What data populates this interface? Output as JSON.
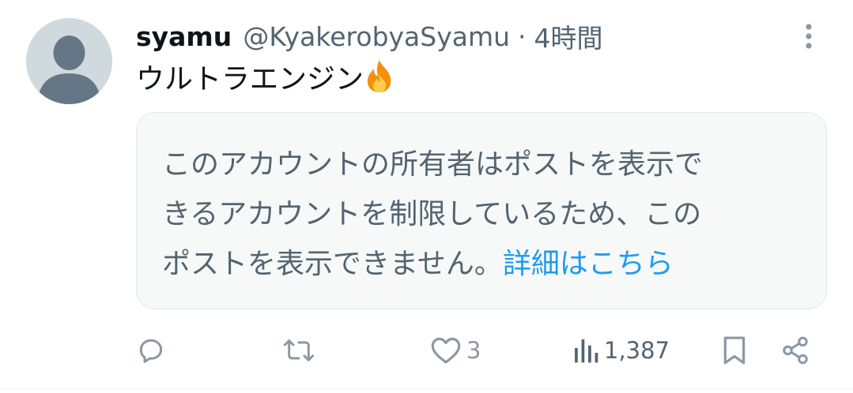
{
  "tweet": {
    "author_name": "syamu",
    "handle": "@KyakerobyaSyamu",
    "separator": "·",
    "time": "4時間",
    "text": "ウルトラエンジン",
    "emoji": "fire-emoji"
  },
  "notice": {
    "line1": "このアカウントの所有者はポストを表示で",
    "line2": "きるアカウントを制限しているため、この",
    "line3": "ポストを表示できません。",
    "link": "詳細はこちら"
  },
  "actions": {
    "reply_count": "",
    "repost_count": "",
    "like_count": "3",
    "views_count": "1,387"
  },
  "colors": {
    "text_primary": "#0f1419",
    "text_secondary": "#536471",
    "link": "#1d9bf0",
    "notice_bg": "#f7f9f9",
    "icon_gray": "#8b98a5"
  }
}
